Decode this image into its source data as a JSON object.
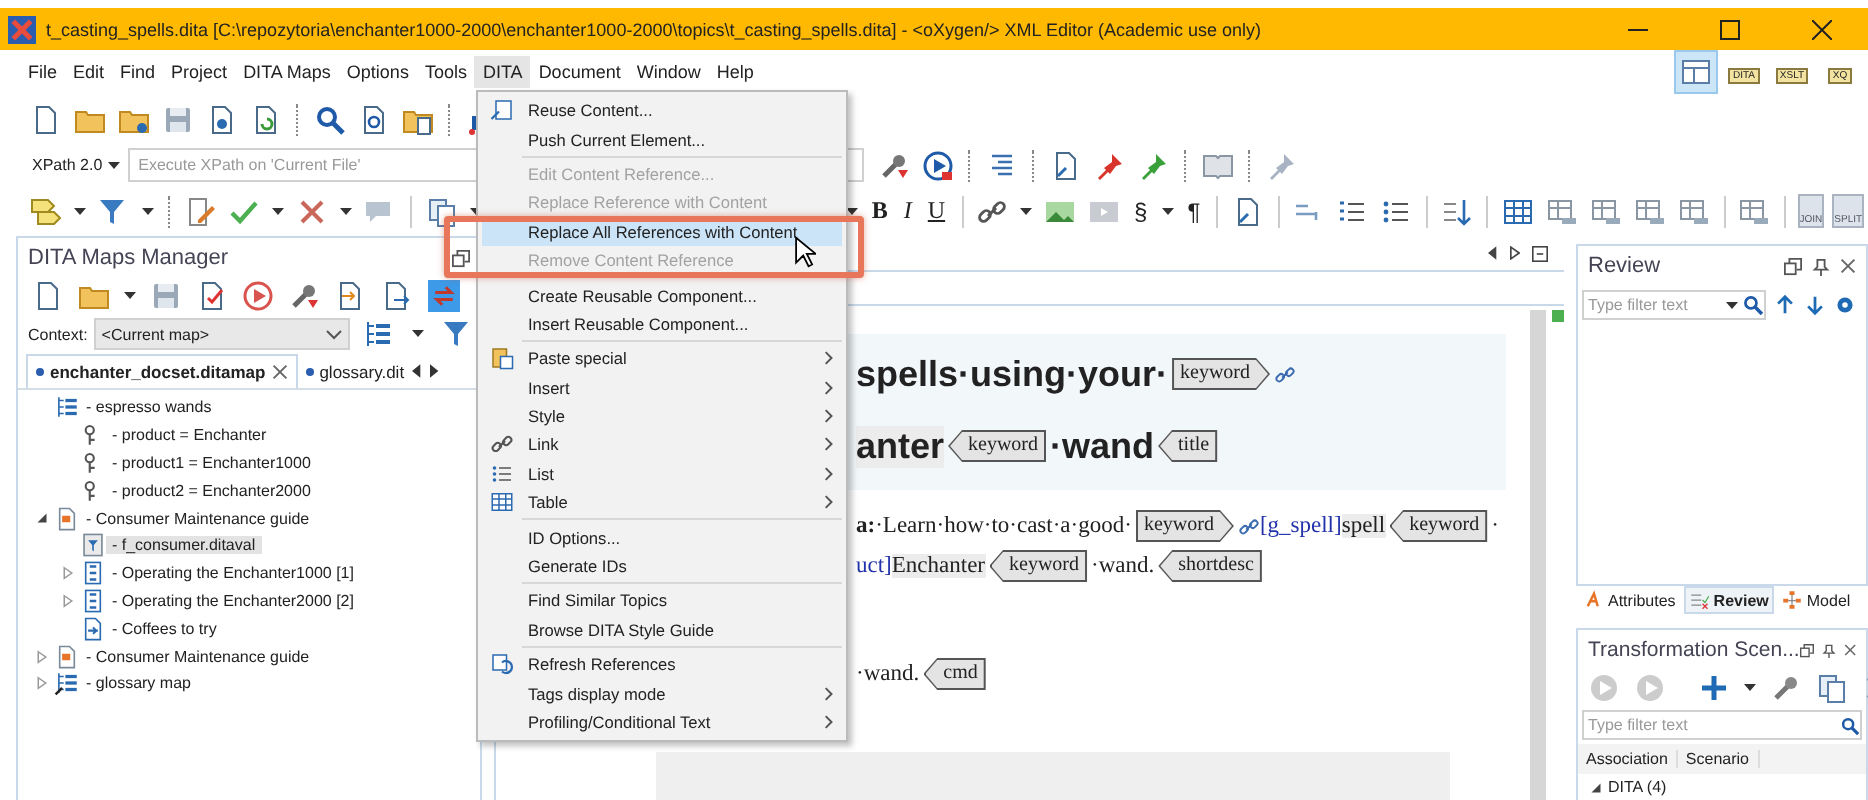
{
  "window": {
    "title": "t_casting_spells.dita [C:\\repozytoria\\enchanter1000-2000\\enchanter1000-2000\\topics\\t_casting_spells.dita] - <oXygen/> XML Editor (Academic use only)"
  },
  "menu_bar": [
    {
      "label": "File",
      "selected": false
    },
    {
      "label": "Edit",
      "selected": false
    },
    {
      "label": "Find",
      "selected": false
    },
    {
      "label": "Project",
      "selected": false
    },
    {
      "label": "DITA Maps",
      "selected": false
    },
    {
      "label": "Options",
      "selected": false
    },
    {
      "label": "Tools",
      "selected": false
    },
    {
      "label": "DITA",
      "selected": true
    },
    {
      "label": "Document",
      "selected": false
    },
    {
      "label": "Window",
      "selected": false
    },
    {
      "label": "Help",
      "selected": false
    }
  ],
  "perspectives": [
    {
      "selected": true
    },
    {
      "label": "DITA",
      "selected": false
    },
    {
      "label": "XSLT",
      "selected": false
    },
    {
      "label": "XQ",
      "selected": false
    }
  ],
  "xpath": {
    "version": "XPath 2.0",
    "placeholder": "Execute XPath on 'Current File'"
  },
  "format_buttons": [
    "B",
    "I",
    "U"
  ],
  "symbol_buttons": [
    "§",
    "¶"
  ],
  "table_tools": [
    "JOIN",
    "SPLIT"
  ],
  "maps_manager": {
    "title": "DITA Maps Manager",
    "link_toggle_on": true,
    "context_label": "Context:",
    "context_value": "<Current map>",
    "tabs": [
      {
        "label": "enchanter_docset.ditamap",
        "selected": true
      },
      {
        "label": "glossary.dit",
        "selected": false
      }
    ],
    "tree": [
      {
        "label": "- espresso wands",
        "selected": false,
        "children": [
          {
            "label": "- product = Enchanter",
            "selected": false
          },
          {
            "label": "- product1 = Enchanter1000",
            "selected": false
          },
          {
            "label": "- product2 = Enchanter2000",
            "selected": false
          }
        ]
      },
      {
        "label": "- Consumer Maintenance guide",
        "expanded": true,
        "selected": false,
        "children": [
          {
            "label": "- f_consumer.ditaval",
            "selected": true
          },
          {
            "label": "- Operating the Enchanter1000 [1]",
            "expanded": false,
            "selected": false
          },
          {
            "label": "- Operating the Enchanter2000 [2]",
            "expanded": false,
            "selected": false
          },
          {
            "label": "- Coffees to try",
            "selected": false
          }
        ]
      },
      {
        "label": "- Consumer Maintenance guide",
        "expanded": false,
        "selected": false
      },
      {
        "label": "- glossary map",
        "expanded": false,
        "selected": false
      }
    ]
  },
  "editor": {
    "lines": [
      {
        "kind": "heading",
        "segments": [
          {
            "kind": "text",
            "text": "spells·using·your·"
          },
          {
            "kind": "tag_open",
            "text": "keyword"
          },
          {
            "kind": "link"
          }
        ]
      },
      {
        "kind": "heading",
        "segments": [
          {
            "kind": "keyref",
            "text": "anter"
          },
          {
            "kind": "tag_close",
            "text": "keyword"
          },
          {
            "kind": "text",
            "text": "·wand"
          },
          {
            "kind": "tag_close",
            "text": "title"
          }
        ]
      },
      {
        "kind": "para",
        "segments": [
          {
            "kind": "bold",
            "text": "a:"
          },
          {
            "kind": "text",
            "text": "·Learn·how·to·cast·a·good·"
          },
          {
            "kind": "tag_open",
            "text": "keyword"
          },
          {
            "kind": "link"
          },
          {
            "kind": "ref",
            "text": "[g_spell]"
          },
          {
            "kind": "keyref",
            "text": "spell"
          },
          {
            "kind": "tag_close",
            "text": "keyword"
          },
          {
            "kind": "text",
            "text": "·"
          }
        ]
      },
      {
        "kind": "para",
        "segments": [
          {
            "kind": "ref",
            "text": "uct]"
          },
          {
            "kind": "keyref",
            "text": "Enchanter"
          },
          {
            "kind": "tag_close",
            "text": "keyword"
          },
          {
            "kind": "text",
            "text": "·wand."
          },
          {
            "kind": "tag_close",
            "text": "shortdesc"
          }
        ]
      },
      {
        "kind": "step",
        "segments": [
          {
            "kind": "text",
            "text": "·wand."
          },
          {
            "kind": "tag_close",
            "text": "cmd"
          }
        ]
      }
    ]
  },
  "dita_menu": [
    {
      "kind": "item",
      "label": "Reuse Content...",
      "disabled": false,
      "selected": false,
      "submenu": false
    },
    {
      "kind": "item",
      "label": "Push Current Element...",
      "disabled": false,
      "selected": false,
      "submenu": false
    },
    {
      "kind": "separator"
    },
    {
      "kind": "item",
      "label": "Edit Content Reference...",
      "disabled": true,
      "selected": false,
      "submenu": false
    },
    {
      "kind": "item",
      "label": "Replace Reference with Content",
      "disabled": true,
      "selected": false,
      "submenu": false
    },
    {
      "kind": "item",
      "label": "Replace All References with Content",
      "disabled": false,
      "selected": true,
      "submenu": false
    },
    {
      "kind": "item",
      "label": "Remove Content Reference",
      "disabled": true,
      "selected": false,
      "submenu": false
    },
    {
      "kind": "separator"
    },
    {
      "kind": "item",
      "label": "Create Reusable Component...",
      "disabled": false,
      "selected": false,
      "submenu": false
    },
    {
      "kind": "item",
      "label": "Insert Reusable Component...",
      "disabled": false,
      "selected": false,
      "submenu": false
    },
    {
      "kind": "separator"
    },
    {
      "kind": "item",
      "label": "Paste special",
      "disabled": false,
      "selected": false,
      "submenu": true
    },
    {
      "kind": "item",
      "label": "Insert",
      "disabled": false,
      "selected": false,
      "submenu": true
    },
    {
      "kind": "item",
      "label": "Style",
      "disabled": false,
      "selected": false,
      "submenu": true
    },
    {
      "kind": "item",
      "label": "Link",
      "disabled": false,
      "selected": false,
      "submenu": true
    },
    {
      "kind": "item",
      "label": "List",
      "disabled": false,
      "selected": false,
      "submenu": true
    },
    {
      "kind": "item",
      "label": "Table",
      "disabled": false,
      "selected": false,
      "submenu": true
    },
    {
      "kind": "separator"
    },
    {
      "kind": "item",
      "label": "ID Options...",
      "disabled": false,
      "selected": false,
      "submenu": false
    },
    {
      "kind": "item",
      "label": "Generate IDs",
      "disabled": false,
      "selected": false,
      "submenu": false
    },
    {
      "kind": "separator"
    },
    {
      "kind": "item",
      "label": "Find Similar Topics",
      "disabled": false,
      "selected": false,
      "submenu": false
    },
    {
      "kind": "item",
      "label": "Browse DITA Style Guide",
      "disabled": false,
      "selected": false,
      "submenu": false
    },
    {
      "kind": "separator"
    },
    {
      "kind": "item",
      "label": "Refresh References",
      "disabled": false,
      "selected": false,
      "submenu": false
    },
    {
      "kind": "item",
      "label": "Tags display mode",
      "disabled": false,
      "selected": false,
      "submenu": true
    },
    {
      "kind": "item",
      "label": "Profiling/Conditional Text",
      "disabled": false,
      "selected": false,
      "submenu": true
    }
  ],
  "review": {
    "title": "Review",
    "filter_placeholder": "Type filter text"
  },
  "side_tabs": [
    {
      "label": "Attributes",
      "selected": false
    },
    {
      "label": "Review",
      "selected": true
    },
    {
      "label": "Model",
      "selected": false
    }
  ],
  "transformation": {
    "title": "Transformation Scen...",
    "filter_placeholder": "Type filter text",
    "columns": [
      "Association",
      "Scenario"
    ],
    "rows": [
      {
        "label": "DITA (4)",
        "expanded": true
      }
    ]
  }
}
